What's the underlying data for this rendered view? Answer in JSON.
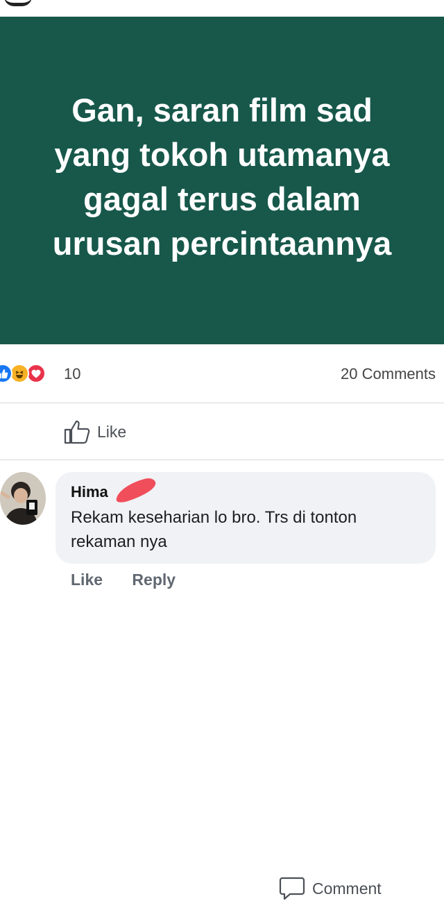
{
  "post": {
    "text_lines": [
      "Gan, saran film sad",
      "yang tokoh utamanya",
      "gagal terus dalam",
      "urusan percintaannya"
    ],
    "background_color": "#17584b"
  },
  "stats": {
    "reactions": [
      "like-icon",
      "haha-icon",
      "love-icon"
    ],
    "reaction_count": "10",
    "comments_count": "20 Comments"
  },
  "actions": {
    "like_label": "Like",
    "comment_label": "Comment"
  },
  "comment": {
    "name": "Hima",
    "text": "Rekam keseharian lo bro. Trs di tonton rekaman nya",
    "like_label": "Like",
    "reply_label": "Reply"
  }
}
